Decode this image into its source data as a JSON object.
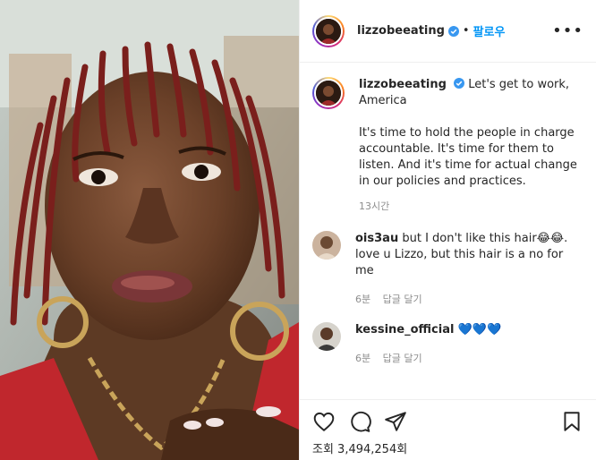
{
  "post": {
    "username": "lizzobeeating",
    "follow_label": "팔로우",
    "more_label": "•••"
  },
  "caption": {
    "username": "lizzobeeating",
    "line1": "Let's get to work, America",
    "para2": "It's time to hold the people in charge accountable. It's time for them to listen. And it's time for actual change in our policies and practices.",
    "time": "13시간"
  },
  "comments": [
    {
      "username": "ois3au",
      "text": "but I don't like this hair😂😂. love u Lizzo, but this hair is a no for me",
      "time": "6분",
      "reply_label": "답글 달기"
    },
    {
      "username": "kessine_official",
      "text": "💙💙💙",
      "time": "6분",
      "reply_label": "답글 달기"
    }
  ],
  "footer": {
    "views": "조회 3,494,254회"
  },
  "icons": {
    "like": "heart-outline-icon",
    "comment": "speech-bubble-icon",
    "share": "paper-plane-icon",
    "save": "bookmark-icon",
    "verified": "verified-badge-icon"
  },
  "colors": {
    "accent": "#0095f6",
    "text": "#262626",
    "muted": "#8e8e8e",
    "border": "#efefef"
  }
}
